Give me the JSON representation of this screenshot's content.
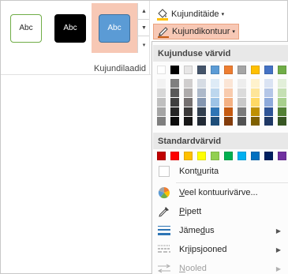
{
  "shape_styles": {
    "group_label": "Kujundilaadid",
    "swatches": [
      {
        "label": "Abc",
        "fill": "#ffffff",
        "border": "#70ad47",
        "text": "#262626",
        "selected": false
      },
      {
        "label": "Abc",
        "fill": "#000000",
        "border": "#000000",
        "text": "#ffffff",
        "selected": false
      },
      {
        "label": "Abc",
        "fill": "#5b9bd5",
        "border": "#41719c",
        "text": "#ffffff",
        "selected": true
      }
    ],
    "scroll": {
      "up": "▲",
      "down": "▼",
      "more": "▾"
    }
  },
  "commands": {
    "fill_label": "Kujunditäide",
    "outline_label": "Kujundikontuur",
    "arrow": "▾"
  },
  "dropdown": {
    "theme_header": "Kujunduse värvid",
    "theme_top": [
      "#ffffff",
      "#000000",
      "#e7e6e6",
      "#44546a",
      "#5b9bd5",
      "#ed7d31",
      "#a5a5a5",
      "#ffc000",
      "#4472c4",
      "#70ad47"
    ],
    "theme_shades": [
      [
        "#f2f2f2",
        "#7f7f7f",
        "#d0cece",
        "#d6dce4",
        "#deebf6",
        "#fbe5d5",
        "#ededed",
        "#fff2cc",
        "#dae3f3",
        "#e2efd9"
      ],
      [
        "#d8d8d8",
        "#595959",
        "#aeabab",
        "#adb9ca",
        "#bdd7ee",
        "#f8cbad",
        "#dbdbdb",
        "#fee599",
        "#b4c6e7",
        "#c5e0b3"
      ],
      [
        "#bfbfbf",
        "#3f3f3f",
        "#757070",
        "#8496b0",
        "#9dc3e6",
        "#f4b183",
        "#c9c9c9",
        "#ffd965",
        "#8eaadb",
        "#a8d08d"
      ],
      [
        "#a5a5a5",
        "#262626",
        "#3a3838",
        "#323f4f",
        "#2e75b5",
        "#c55a11",
        "#7b7b7b",
        "#bf9000",
        "#2f5496",
        "#538135"
      ],
      [
        "#7f7f7f",
        "#0c0c0c",
        "#171616",
        "#222a35",
        "#1e4e79",
        "#833c0b",
        "#525252",
        "#7f6000",
        "#1f3864",
        "#375623"
      ]
    ],
    "standard_header": "Standardvärvid",
    "standard": [
      "#c00000",
      "#ff0000",
      "#ffc000",
      "#ffff00",
      "#92d050",
      "#00b050",
      "#00b0f0",
      "#0070c0",
      "#002060",
      "#7030a0"
    ],
    "items": {
      "no_outline": {
        "pre": "Kont",
        "ul": "u",
        "post": "urita"
      },
      "more_colors": {
        "pre": "",
        "ul": "V",
        "post": "eel kontuurivärve..."
      },
      "eyedropper": {
        "pre": "",
        "ul": "P",
        "post": "ipett"
      },
      "weight": {
        "pre": "Jäme",
        "ul": "d",
        "post": "us"
      },
      "dashes": {
        "pre": "Kr",
        "ul": "i",
        "post": "ipsjooned"
      },
      "arrows": {
        "pre": "",
        "ul": "N",
        "post": "ooled"
      }
    },
    "submenu_arrow": "▶"
  }
}
